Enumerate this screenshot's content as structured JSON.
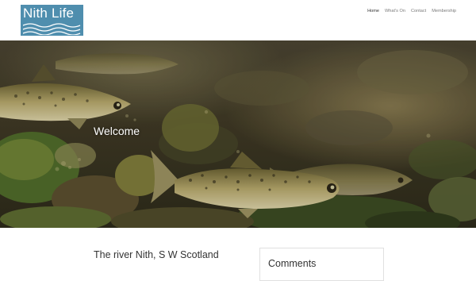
{
  "header": {
    "logo_text": "Nith Life",
    "nav": [
      {
        "label": "Home"
      },
      {
        "label": "What's On"
      },
      {
        "label": "Contact"
      },
      {
        "label": "Membership"
      }
    ]
  },
  "hero": {
    "title": "Welcome",
    "image_subject": "brown trout fish swimming over river stones"
  },
  "main": {
    "heading": "The river Nith, S W Scotland"
  },
  "sidebar": {
    "comments_title": "Comments"
  },
  "colors": {
    "logo_bg": "#4f8eae",
    "nav_active": "#333333",
    "nav_text": "#7a7a7a",
    "heading_text": "#333333"
  }
}
